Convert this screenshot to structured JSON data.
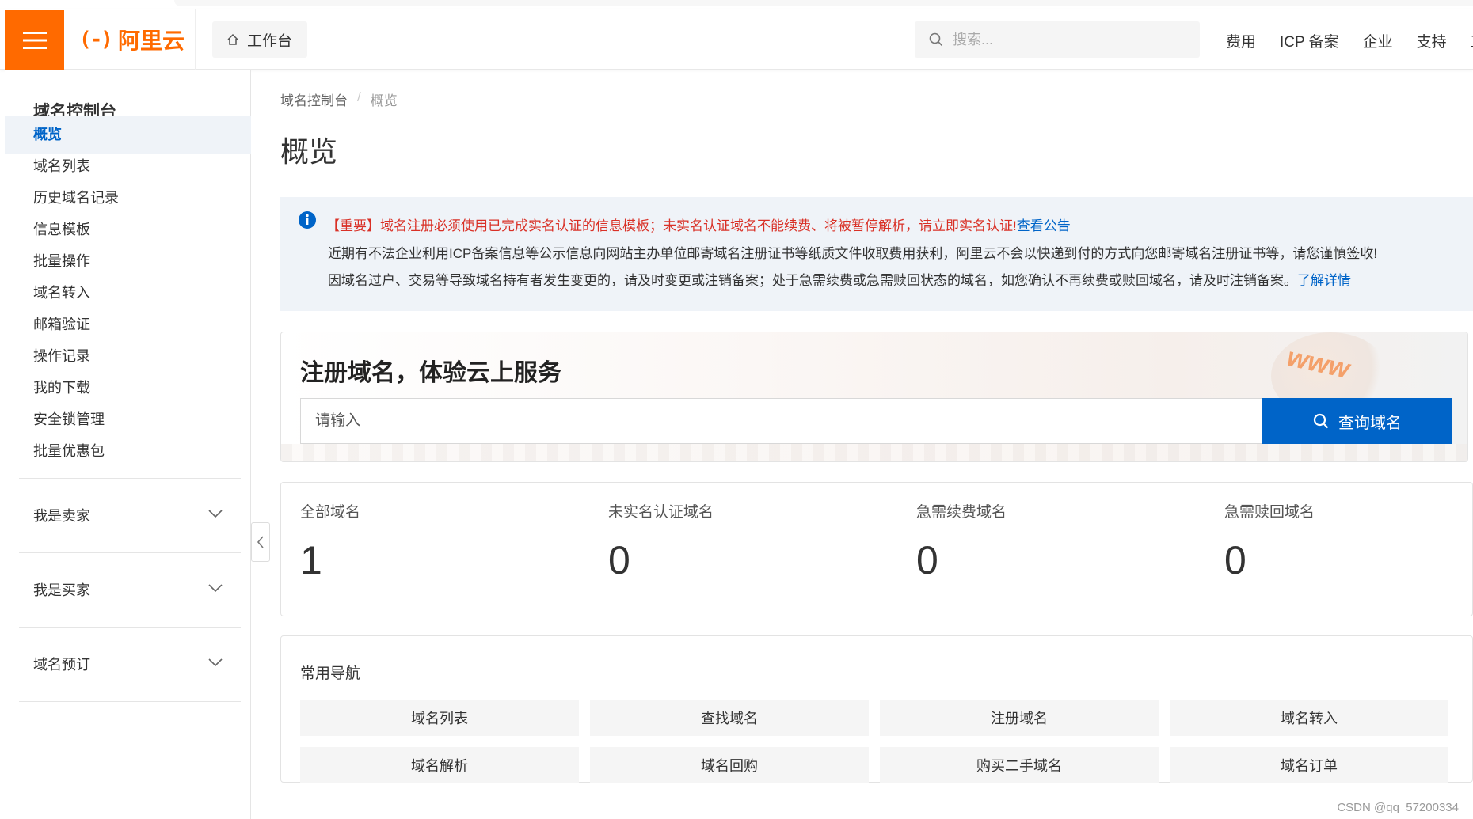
{
  "header": {
    "logo_text": "阿里云",
    "logo_mark": "(-)",
    "workbench_label": "工作台",
    "search_placeholder": "搜索...",
    "links": [
      "费用",
      "ICP 备案",
      "企业",
      "支持",
      "工"
    ]
  },
  "sidebar": {
    "title": "域名控制台",
    "items": [
      {
        "label": "概览",
        "active": true
      },
      {
        "label": "域名列表"
      },
      {
        "label": "历史域名记录"
      },
      {
        "label": "信息模板"
      },
      {
        "label": "批量操作"
      },
      {
        "label": "域名转入"
      },
      {
        "label": "邮箱验证"
      },
      {
        "label": "操作记录"
      },
      {
        "label": "我的下载"
      },
      {
        "label": "安全锁管理"
      },
      {
        "label": "批量优惠包"
      }
    ],
    "groups": [
      "我是卖家",
      "我是买家",
      "域名预订"
    ]
  },
  "breadcrumb": {
    "root": "域名控制台",
    "sep": "/",
    "current": "概览"
  },
  "page_title": "概览",
  "notice": {
    "line1": "【重要】域名注册必须使用已完成实名认证的信息模板；未实名认证域名不能续费、将被暂停解析，请立即实名认证!",
    "line1_link": "查看公告",
    "line2": "近期有不法企业利用ICP备案信息等公示信息向网站主办单位邮寄域名注册证书等纸质文件收取费用获利，阿里云不会以快递到付的方式向您邮寄域名注册证书等，请您谨慎签收!",
    "line3": "因域名过户、交易等导致域名持有者发生变更的，请及时变更或注销备案；处于急需续费或急需赎回状态的域名，如您确认不再续费或赎回域名，请及时注销备案。",
    "line3_link": "了解详情"
  },
  "register": {
    "heading": "注册域名，体验云上服务",
    "placeholder": "请输入",
    "button": "查询域名",
    "decor_text": "www"
  },
  "stats": [
    {
      "label": "全部域名",
      "value": "1"
    },
    {
      "label": "未实名认证域名",
      "value": "0"
    },
    {
      "label": "急需续费域名",
      "value": "0"
    },
    {
      "label": "急需赎回域名",
      "value": "0"
    }
  ],
  "quick_nav": {
    "title": "常用导航",
    "buttons": [
      "域名列表",
      "查找域名",
      "注册域名",
      "域名转入",
      "域名解析",
      "域名回购",
      "购买二手域名",
      "域名订单"
    ]
  },
  "watermark": "CSDN @qq_57200334",
  "colors": {
    "brand": "#ff6a00",
    "primary": "#0064c8",
    "alert": "#d93026",
    "notice_bg": "#eff3f8"
  }
}
